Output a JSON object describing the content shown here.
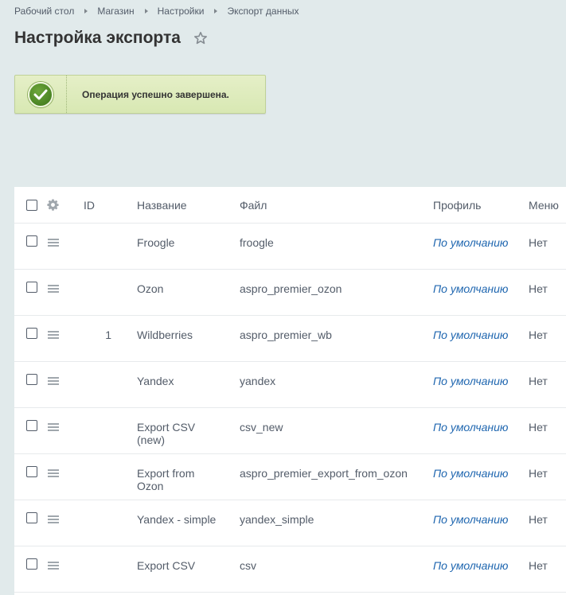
{
  "breadcrumb": [
    "Рабочий стол",
    "Магазин",
    "Настройки",
    "Экспорт данных"
  ],
  "page": {
    "title": "Настройка экспорта"
  },
  "notice": {
    "message": "Операция успешно завершена."
  },
  "table": {
    "columns": {
      "id": "ID",
      "name": "Название",
      "file": "Файл",
      "profile": "Профиль",
      "menu": "Меню"
    },
    "rows": [
      {
        "id": "",
        "name": "Froogle",
        "file": "froogle",
        "profile": "По умолчанию",
        "menu": "Нет"
      },
      {
        "id": "",
        "name": "Ozon",
        "file": "aspro_premier_ozon",
        "profile": "По умолчанию",
        "menu": "Нет"
      },
      {
        "id": "1",
        "name": "Wildberries",
        "file": "aspro_premier_wb",
        "profile": "По умолчанию",
        "menu": "Нет"
      },
      {
        "id": "",
        "name": "Yandex",
        "file": "yandex",
        "profile": "По умолчанию",
        "menu": "Нет"
      },
      {
        "id": "",
        "name": "Export CSV (new)",
        "file": "csv_new",
        "profile": "По умолчанию",
        "menu": "Нет"
      },
      {
        "id": "",
        "name": "Export from Ozon",
        "file": "aspro_premier_export_from_ozon",
        "profile": "По умолчанию",
        "menu": "Нет"
      },
      {
        "id": "",
        "name": "Yandex - simple",
        "file": "yandex_simple",
        "profile": "По умолчанию",
        "menu": "Нет"
      },
      {
        "id": "",
        "name": "Export CSV",
        "file": "csv",
        "profile": "По умолчанию",
        "menu": "Нет"
      }
    ]
  },
  "colors": {
    "background": "#e1eaeb",
    "link": "#2067b0",
    "notice_bg": "#dfecbf",
    "check_green": "#4a8a26"
  }
}
